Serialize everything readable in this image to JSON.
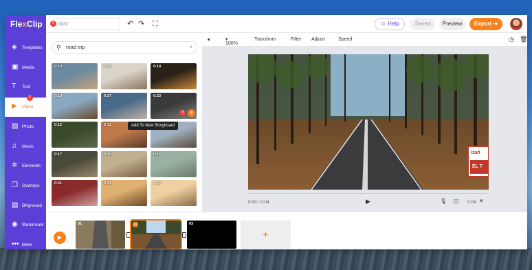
{
  "app": {
    "logo_text_1": "Fle",
    "logo_text_2": "x",
    "logo_text_3": "Clip",
    "project_name": "dust",
    "help": "Help",
    "saved": "Saved",
    "preview": "Preview",
    "export": "Export"
  },
  "sidebar": {
    "items": [
      {
        "label": "Templates",
        "icon": "templates-icon",
        "glyph": "◈"
      },
      {
        "label": "Media",
        "icon": "media-icon",
        "glyph": "▣"
      },
      {
        "label": "Text",
        "icon": "text-icon",
        "glyph": "T"
      },
      {
        "label": "Video",
        "icon": "video-icon",
        "glyph": "▶"
      },
      {
        "label": "Photo",
        "icon": "photo-icon",
        "glyph": "▨"
      },
      {
        "label": "Music",
        "icon": "music-icon",
        "glyph": "♫"
      },
      {
        "label": "Elements",
        "icon": "elements-icon",
        "glyph": "✲"
      },
      {
        "label": "Overlays",
        "icon": "overlays-icon",
        "glyph": "❐"
      },
      {
        "label": "BKground",
        "icon": "background-icon",
        "glyph": "▧"
      },
      {
        "label": "Watermark",
        "icon": "watermark-icon",
        "glyph": "◉"
      },
      {
        "label": "More",
        "icon": "more-icon",
        "glyph": "•••"
      }
    ],
    "video_badge": "1"
  },
  "panel": {
    "search_value": "road trip",
    "search_badge": "2",
    "thumbs": [
      {
        "dur": "0:19"
      },
      {
        "dur": "0:29"
      },
      {
        "dur": "0:14"
      },
      {
        "dur": "0:10"
      },
      {
        "dur": "0:27"
      },
      {
        "dur": "0:23"
      },
      {
        "dur": "0:12"
      },
      {
        "dur": "0:11"
      },
      {
        "dur": "0:14"
      },
      {
        "dur": "0:17"
      },
      {
        "dur": "0:30"
      },
      {
        "dur": "0:16"
      },
      {
        "dur": "0:21"
      },
      {
        "dur": "0:14"
      },
      {
        "dur": "0:17"
      }
    ],
    "tooltip": "Add To New Storyboard",
    "hover_badge": "3",
    "add_glyph": "+"
  },
  "toolbar": {
    "zoom": "100%",
    "transform": "Transform",
    "filter": "Filter",
    "adjust": "Adjust",
    "speed": "Speed"
  },
  "player": {
    "time_current": "0:00 / 0:04",
    "time_end": "0:04",
    "sign_line1": "Izañ",
    "sign_line2": "EL T"
  },
  "timeline": {
    "clips": [
      {
        "num": "01"
      },
      {
        "num": "02"
      },
      {
        "num": "03"
      }
    ],
    "add_glyph": "+"
  },
  "colors": {
    "brand_purple": "#5b3fd6",
    "accent_orange": "#f7821b",
    "badge_red": "#e8413a"
  }
}
